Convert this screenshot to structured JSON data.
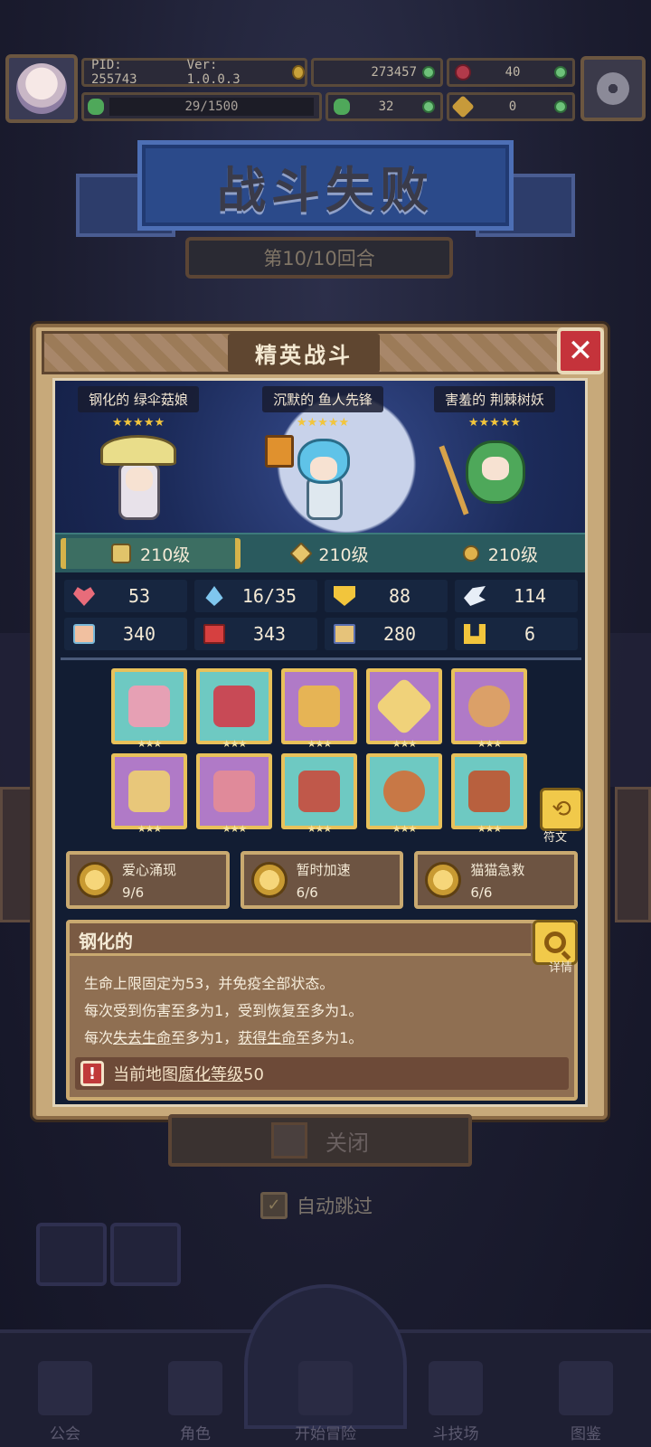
{
  "topbar": {
    "pid": "PID: 255743",
    "version": "Ver: 1.0.0.3",
    "gold": "273457",
    "gems": "40",
    "xp": "29/1500",
    "clover": "32",
    "keys": "0"
  },
  "defeat": {
    "title": "战斗失败",
    "round": "第10/10回合"
  },
  "modal": {
    "title": "精英战斗",
    "close_symbol": "✕"
  },
  "heroes": [
    {
      "name": "钢化的 绿伞菇娘",
      "stars": "★★★★★"
    },
    {
      "name": "沉默的 鱼人先锋",
      "stars": "★★★★★"
    },
    {
      "name": "害羞的 荆棘树妖",
      "stars": "★★★★★"
    }
  ],
  "levels": [
    "210级",
    "210级",
    "210级"
  ],
  "stats": {
    "hp": "53",
    "mp": "16/35",
    "defense": "88",
    "speed": "114",
    "attack": "340",
    "magic": "343",
    "agility": "280",
    "luck": "6"
  },
  "equipment_stars": "★★★",
  "rune_label": "符文",
  "skills": [
    {
      "name": "爱心涌现",
      "count": "9/6"
    },
    {
      "name": "暂时加速",
      "count": "6/6"
    },
    {
      "name": "猫猫急救",
      "count": "6/6"
    }
  ],
  "description": {
    "title": "钢化的",
    "detail_label": "详情",
    "line1": "生命上限固定为53，并免疫全部状态。",
    "line2": "每次受到伤害至多为1，受到恢复至多为1。",
    "line3_a": "每次",
    "line3_b": "失去生命",
    "line3_c": "至多为1，",
    "line3_d": "获得生命",
    "line3_e": "至多为1。",
    "warning_a": "当前地图",
    "warning_b": "腐化等级",
    "warning_c": "50",
    "warning_icon": "!"
  },
  "bottom": {
    "close_label": "关闭",
    "auto_skip": "自动跳过",
    "checkmark": "✓",
    "nav": [
      "公会",
      "角色",
      "开始冒险",
      "斗技场",
      "图鉴"
    ]
  },
  "colors": {
    "modal_frame": "#c7a97a",
    "close_red": "#c5333b",
    "star_gold": "#f2c53c"
  }
}
